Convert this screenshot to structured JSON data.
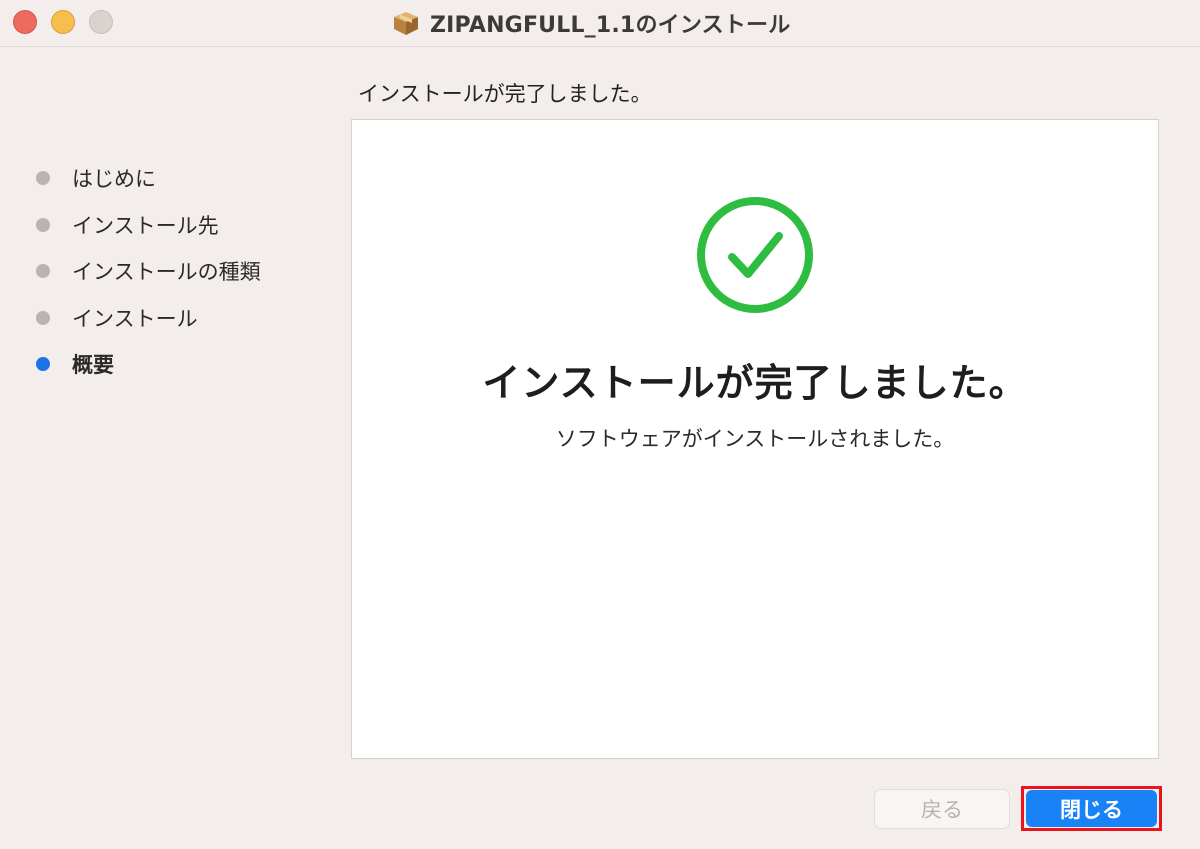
{
  "window": {
    "title": "ZIPANGFULL_1.1のインストール",
    "icon": "package-icon"
  },
  "sidebar": {
    "steps": [
      {
        "label": "はじめに",
        "active": false
      },
      {
        "label": "インストール先",
        "active": false
      },
      {
        "label": "インストールの種類",
        "active": false
      },
      {
        "label": "インストール",
        "active": false
      },
      {
        "label": "概要",
        "active": true
      }
    ]
  },
  "main": {
    "heading": "インストールが完了しました。",
    "success_title": "インストールが完了しました。",
    "success_message": "ソフトウェアがインストールされました。",
    "icon": "checkmark-circle-icon"
  },
  "footer": {
    "back_label": "戻る",
    "close_label": "閉じる"
  },
  "colors": {
    "accent": "#1a82f7",
    "success": "#2ebd40",
    "highlight": "#e8141e",
    "active_step": "#1a73e8",
    "inactive_step": "#b9b4b0"
  }
}
